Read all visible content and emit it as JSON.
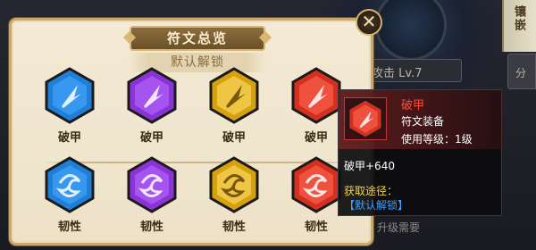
{
  "panel": {
    "title": "符文总览",
    "subtitle": "默认解锁"
  },
  "runes_row1": [
    {
      "label": "破甲",
      "color": "#1f7fd6",
      "icon": "armor-break-rune-icon"
    },
    {
      "label": "破甲",
      "color": "#8a34d8",
      "icon": "armor-break-rune-icon"
    },
    {
      "label": "破甲",
      "color": "#d6a10f",
      "icon": "armor-break-rune-icon"
    },
    {
      "label": "破甲",
      "color": "#d42f1f",
      "icon": "armor-break-rune-icon"
    }
  ],
  "runes_row2": [
    {
      "label": "韧性",
      "color": "#1f7fd6",
      "icon": "toughness-rune-icon"
    },
    {
      "label": "韧性",
      "color": "#8a34d8",
      "icon": "toughness-rune-icon"
    },
    {
      "label": "韧性",
      "color": "#d6a10f",
      "icon": "toughness-rune-icon"
    },
    {
      "label": "韧性",
      "color": "#d42f1f",
      "icon": "toughness-rune-icon"
    }
  ],
  "tooltip": {
    "name": "破甲",
    "type": "符文装备",
    "level": "使用等级：1级",
    "stat": "破甲+640",
    "source_title": "获取途径：",
    "source": "【默认解锁】"
  },
  "background": {
    "attack": "攻击 Lv.7",
    "upgrade": "升级需要",
    "side_tab": "镶嵌",
    "side_tab2": "分"
  },
  "close_icon": "close-icon"
}
